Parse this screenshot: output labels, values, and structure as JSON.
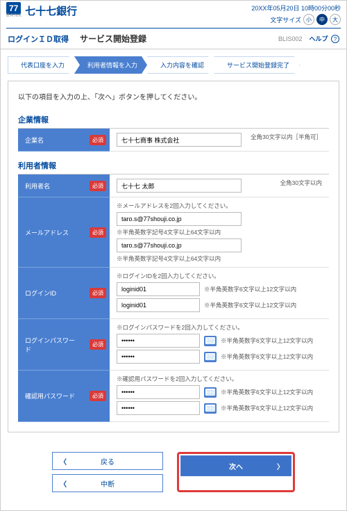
{
  "top": {
    "logo_num": "77",
    "logo_sub": "BANK",
    "bank_name": "七十七銀行",
    "datetime": "20XX年05月20日 10時00分00秒",
    "font_size_label": "文字サイズ",
    "fs_small": "小",
    "fs_mid": "中",
    "fs_large": "大"
  },
  "header": {
    "title_sub": "ログインＩＤ取得",
    "title_main": "サービス開始登録",
    "screen_code": "BLIS002",
    "help_label": "ヘルプ",
    "help_q": "?"
  },
  "steps": {
    "s1": "代表口座を入力",
    "s2": "利用者情報を入力",
    "s3": "入力内容を確認",
    "s4": "サービス開始登録完了"
  },
  "instruction": "以下の項目を入力の上、「次へ」ボタンを押してください。",
  "sec1_title": "企業情報",
  "sec2_title": "利用者情報",
  "required_badge": "必須",
  "rows": {
    "company": {
      "label": "企業名",
      "value": "七十七商事 株式会社",
      "hint_right": "全角30文字以内［半角可］"
    },
    "user": {
      "label": "利用者名",
      "value": "七十七 太郎",
      "hint_right": "全角30文字以内"
    },
    "mail": {
      "label": "メールアドレス",
      "top_hint": "※メールアドレスを2回入力してください。",
      "v1": "taro.s@77shouji.co.jp",
      "h1": "※半角英数字記号4文字以上64文字以内",
      "v2": "taro.s@77shouji.co.jp",
      "h2": "※半角英数字記号4文字以上64文字以内"
    },
    "login": {
      "label": "ログインID",
      "top_hint": "※ログインIDを2回入力してください。",
      "v1": "loginid01",
      "h1": "※半角英数字6文字以上12文字以内",
      "v2": "loginid01",
      "h2": "※半角英数字6文字以上12文字以内"
    },
    "lpw": {
      "label": "ログインパスワード",
      "top_hint": "※ログインパスワードを2回入力してください。",
      "v1": "••••••",
      "h1": "※半角英数字6文字以上12文字以内",
      "v2": "••••••",
      "h2": "※半角英数字6文字以上12文字以内"
    },
    "cpw": {
      "label": "確認用パスワード",
      "top_hint": "※確認用パスワードを2回入力してください。",
      "v1": "••••••",
      "h1": "※半角英数字6文字以上12文字以内",
      "v2": "••••••",
      "h2": "※半角英数字6文字以上12文字以内"
    }
  },
  "buttons": {
    "back": "戻る",
    "cancel": "中断",
    "next": "次へ"
  }
}
